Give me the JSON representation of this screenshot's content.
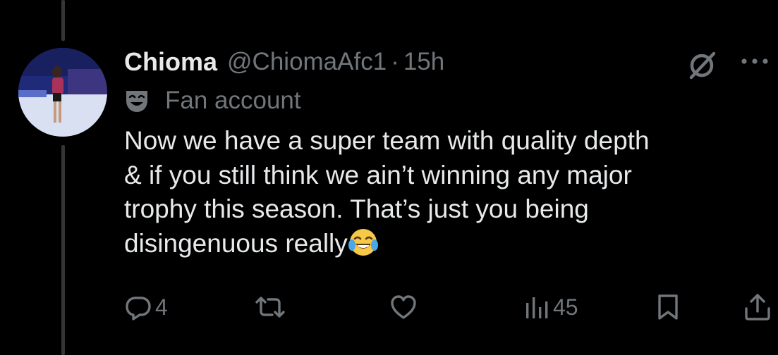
{
  "tweet": {
    "display_name": "Chioma",
    "handle": "@ChiomaAfc1",
    "separator": "·",
    "time": "15h",
    "label": "Fan account",
    "text_lines": [
      "Now we have a super team with quality depth",
      "& if you still think we ain’t winning any major",
      "trophy this season. That’s just you being",
      "disingenuous really"
    ]
  },
  "actions": {
    "reply_count": "4",
    "views_count": "45"
  },
  "icons": {
    "label_icon": "theater-mask-icon",
    "emoji": "tears-of-joy-emoji",
    "grok": "grok-icon",
    "more": "more-options-icon",
    "reply": "reply-icon",
    "repost": "repost-icon",
    "like": "like-icon",
    "views": "views-icon",
    "bookmark": "bookmark-icon",
    "share": "share-icon"
  },
  "colors": {
    "background": "#000000",
    "text_primary": "#e7e9ea",
    "text_secondary": "#71767b",
    "thread_line": "#333639"
  }
}
